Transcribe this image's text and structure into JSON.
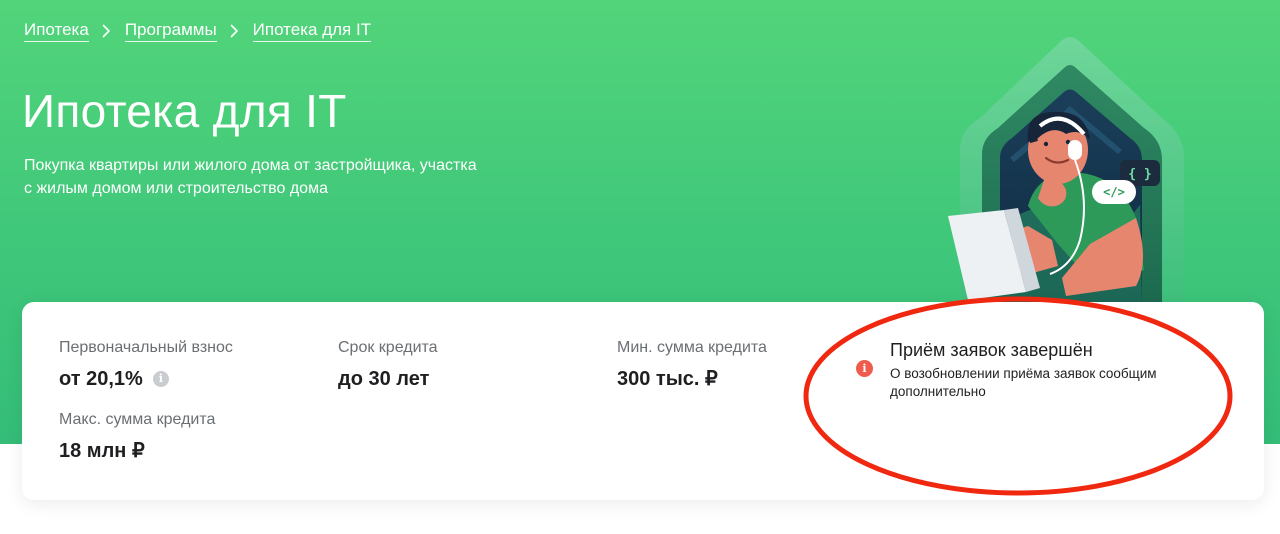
{
  "breadcrumb": {
    "items": [
      {
        "label": "Ипотека"
      },
      {
        "label": "Программы"
      },
      {
        "label": "Ипотека для IT"
      }
    ]
  },
  "hero": {
    "title": "Ипотека для IT",
    "subtitle_line1": "Покупка квартиры или жилого дома от застройщика, участка",
    "subtitle_line2": "с жилым домом или строительство дома",
    "illustration": {
      "icon": "developer-with-laptop-illustration",
      "badge_braces": "{ }",
      "badge_code": "</>"
    }
  },
  "params": {
    "down_payment": {
      "label": "Первоначальный взнос",
      "value": "от 20,1%"
    },
    "term": {
      "label": "Срок кредита",
      "value": "до 30 лет"
    },
    "min_amount": {
      "label": "Мин. сумма кредита",
      "value": "300 тыс. ₽"
    },
    "max_amount": {
      "label": "Макс. сумма кредита",
      "value": "18 млн ₽"
    }
  },
  "notice": {
    "title": "Приём заявок завершён",
    "text": "О возобновлении приёма заявок сообщим дополнительно",
    "icon": "alert-icon"
  },
  "colors": {
    "hero_green_top": "#52d47a",
    "hero_green_bottom": "#34bd78",
    "alert_red": "#ef5b4d",
    "annotation_red": "#f02810"
  }
}
